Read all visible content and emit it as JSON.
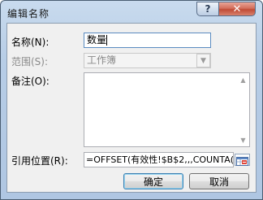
{
  "window": {
    "title": "编辑名称",
    "help_icon": "question-mark-icon",
    "close_icon": "close-x-icon"
  },
  "form": {
    "name_label": "名称(N):",
    "name_value": "数量",
    "scope_label": "范围(S):",
    "scope_value": "工作簿",
    "comment_label": "备注(O):",
    "comment_value": "",
    "refers_to_label": "引用位置(R):",
    "refers_to_value": "=OFFSET(有效性!$B$2,,,COUNTA("
  },
  "buttons": {
    "ok": "确定",
    "cancel": "取消"
  },
  "icons": {
    "collapse_dialog": "range-select-icon",
    "scroll_up": "arrow-up-icon",
    "scroll_down": "arrow-down-icon",
    "dropdown": "chevron-down-icon"
  }
}
